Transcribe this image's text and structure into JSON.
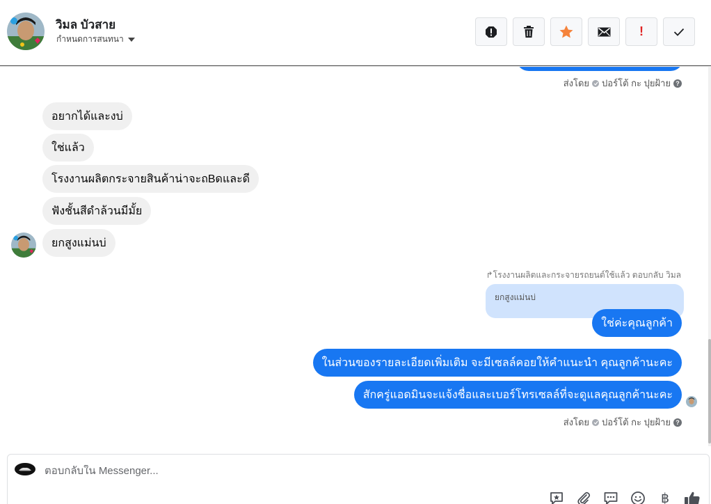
{
  "header": {
    "contact_name": "วิมล บัวสาย",
    "assign_label": "กำหนดการสนทนา",
    "actions": [
      "report-icon",
      "trash-icon",
      "star-icon",
      "mail-icon",
      "important-icon",
      "check-icon"
    ],
    "important_glyph": "!"
  },
  "conversation": {
    "sent_meta_top": {
      "prefix": "ส่งโดย",
      "sender": "ปอร์โต้ กะ ปุยฝ้าย",
      "help": "?"
    },
    "incoming": [
      "อยากได้และงบ่",
      "ใช่แล้ว",
      "โรงงานผลิตกระจายสินค้าน่าจะถBดและดี",
      "ฟังชั้นสีดำล้วนมีมั้ย",
      "ยกสูงแม่นบ่"
    ],
    "reply_note": "↱โรงงานผลิตและกระจายรถยนต์ใช้แล้ว ตอบกลับ วิมล",
    "quoted_text": "ยกสูงแม่นบ่",
    "outgoing": [
      "ใช่ค่ะคุณลูกค้า",
      "ในส่วนของรายละเอียดเพิ่มเติม จะมีเซลล์คอยให้คำแนะนำ คุณลูกค้านะคะ",
      "สักครู่แอดมินจะแจ้งชื่อและเบอร์โทรเซลล์ที่จะดูแลคุณลูกค้านะคะ"
    ],
    "sent_meta_bottom": {
      "prefix": "ส่งโดย",
      "sender": "ปอร์โต้ กะ ปุยฝ้าย",
      "help": "?"
    }
  },
  "composer": {
    "placeholder": "ตอบกลับใน Messenger...",
    "tools": [
      "saved-reply-icon",
      "attachment-icon",
      "chat-bubble-icon",
      "emoji-icon",
      "baht-icon",
      "like-icon"
    ],
    "baht_glyph": "฿"
  },
  "colors": {
    "outgoing_bubble": "#1877f2",
    "incoming_bubble": "#f0f0f0",
    "quoted_bubble": "#d0e3fd",
    "important_red": "#e02424",
    "star_orange": "#f5833b"
  }
}
